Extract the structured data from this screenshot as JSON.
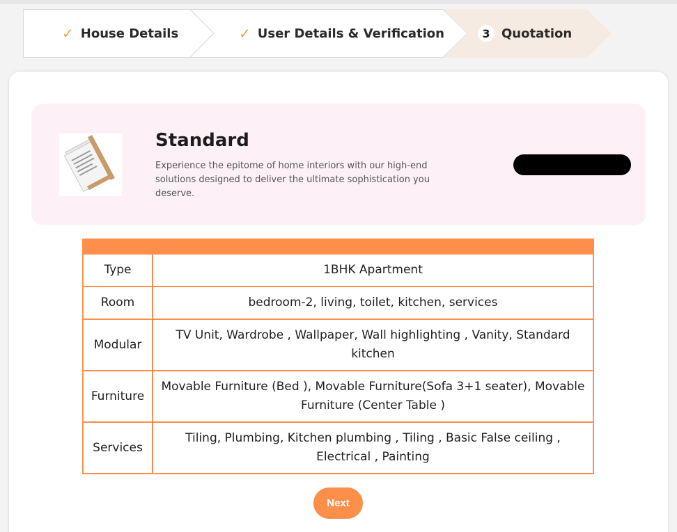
{
  "stepper": {
    "steps": [
      {
        "marker": "✓",
        "label": "House Details",
        "state": "completed"
      },
      {
        "marker": "✓",
        "label": "User Details & Verification",
        "state": "completed"
      },
      {
        "marker": "3",
        "label": "Quotation",
        "state": "active"
      }
    ]
  },
  "plan": {
    "title": "Standard",
    "description": "Experience the epitome of home interiors with our high-end solutions designed to deliver the ultimate sophistication you deserve.",
    "image_icon": "document-icon"
  },
  "details_table": {
    "rows": [
      {
        "label": "Type",
        "value": "1BHK Apartment"
      },
      {
        "label": "Room",
        "value": "bedroom-2, living, toilet, kitchen, services"
      },
      {
        "label": "Modular",
        "value": "TV Unit, Wardrobe , Wallpaper, Wall highlighting , Vanity, Standard kitchen"
      },
      {
        "label": "Furniture",
        "value": "Movable Furniture (Bed ), Movable Furniture(Sofa 3+1 seater), Movable Furniture (Center Table )"
      },
      {
        "label": "Services",
        "value": "Tiling, Plumbing, Kitchen plumbing , Tiling , Basic False ceiling , Electrical , Painting"
      }
    ]
  },
  "actions": {
    "next_label": "Next"
  },
  "colors": {
    "accent": "#fd8f4a",
    "check": "#f0a045",
    "active_step_bg": "#f5ebe2",
    "plan_bg": "#fdf0f7"
  }
}
